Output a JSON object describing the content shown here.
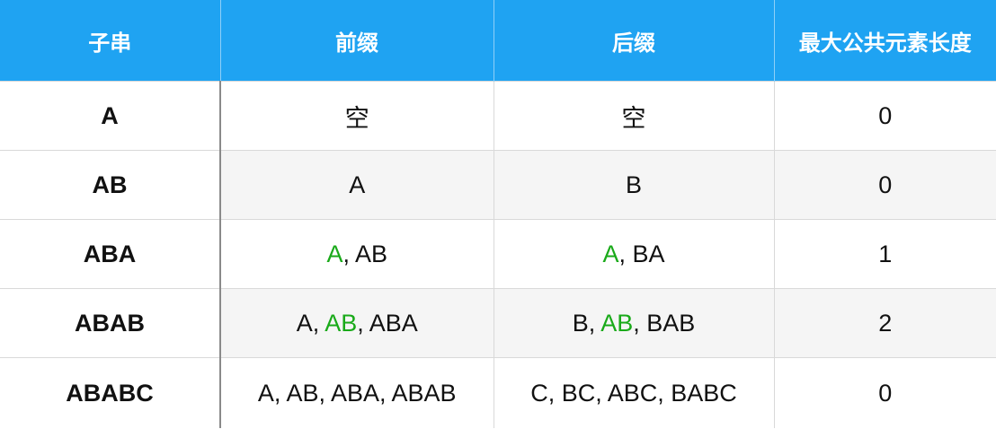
{
  "header": {
    "col1": "子串",
    "col2": "前缀",
    "col3": "后缀",
    "col4": "最大公共元素长度"
  },
  "rows": [
    {
      "substring": "A",
      "prefixes": [
        {
          "text": "空",
          "hl": false
        }
      ],
      "suffixes": [
        {
          "text": "空",
          "hl": false
        }
      ],
      "length": "0"
    },
    {
      "substring": "AB",
      "prefixes": [
        {
          "text": "A",
          "hl": false
        }
      ],
      "suffixes": [
        {
          "text": "B",
          "hl": false
        }
      ],
      "length": "0"
    },
    {
      "substring": "ABA",
      "prefixes": [
        {
          "text": "A",
          "hl": true
        },
        {
          "text": ", ",
          "hl": false
        },
        {
          "text": "AB",
          "hl": false
        }
      ],
      "suffixes": [
        {
          "text": "A",
          "hl": true
        },
        {
          "text": ", ",
          "hl": false
        },
        {
          "text": "BA",
          "hl": false
        }
      ],
      "length": "1"
    },
    {
      "substring": "ABAB",
      "prefixes": [
        {
          "text": "A",
          "hl": false
        },
        {
          "text": ", ",
          "hl": false
        },
        {
          "text": "AB",
          "hl": true
        },
        {
          "text": ", ",
          "hl": false
        },
        {
          "text": "ABA",
          "hl": false
        }
      ],
      "suffixes": [
        {
          "text": "B",
          "hl": false
        },
        {
          "text": ", ",
          "hl": false
        },
        {
          "text": "AB",
          "hl": true
        },
        {
          "text": ", ",
          "hl": false
        },
        {
          "text": "BAB",
          "hl": false
        }
      ],
      "length": "2"
    },
    {
      "substring": "ABABC",
      "prefixes": [
        {
          "text": "A, AB, ABA, ABAB",
          "hl": false
        }
      ],
      "suffixes": [
        {
          "text": "C, BC, ABC, BABC",
          "hl": false
        }
      ],
      "length": "0"
    }
  ],
  "colors": {
    "header_bg": "#1fa3f2",
    "highlight": "#1aaa1a",
    "stripe": "#f5f5f5"
  }
}
